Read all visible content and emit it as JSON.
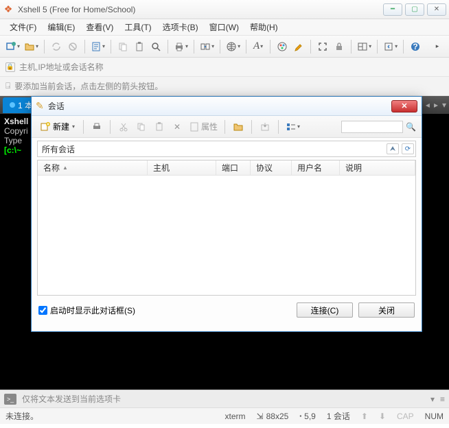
{
  "window": {
    "title": "Xshell 5 (Free for Home/School)"
  },
  "menu": {
    "file": "文件(F)",
    "edit": "编辑(E)",
    "view": "查看(V)",
    "tools": "工具(T)",
    "tabs": "选项卡(B)",
    "window": "窗口(W)",
    "help": "帮助(H)"
  },
  "addressbar": {
    "placeholder": "主机,IP地址或会话名称"
  },
  "hintbar": {
    "text": "要添加当前会话，点击左侧的箭头按钮。"
  },
  "tab": {
    "label": "1 本"
  },
  "terminal": {
    "line1": "Xshell",
    "line2": "Copyri",
    "line3_blank": "",
    "line4": "Type ",
    "line5_prefix": "[c:\\~",
    "line5_suffix": ""
  },
  "sendbar": {
    "text": "仅将文本发送到当前选项卡"
  },
  "status": {
    "connection": "未连接。",
    "term": "xterm",
    "size": "88x25",
    "pos": "5,9",
    "sessions": "1 会话",
    "cap": "CAP",
    "num": "NUM"
  },
  "dialog": {
    "title": "会话",
    "new_label": "新建",
    "properties_label": "属性",
    "path": "所有会话",
    "columns": {
      "name": "名称",
      "host": "主机",
      "port": "端口",
      "protocol": "协议",
      "username": "用户名",
      "description": "说明"
    },
    "show_on_start": "启动时显示此对话框(S)",
    "connect": "连接(C)",
    "close": "关闭"
  }
}
